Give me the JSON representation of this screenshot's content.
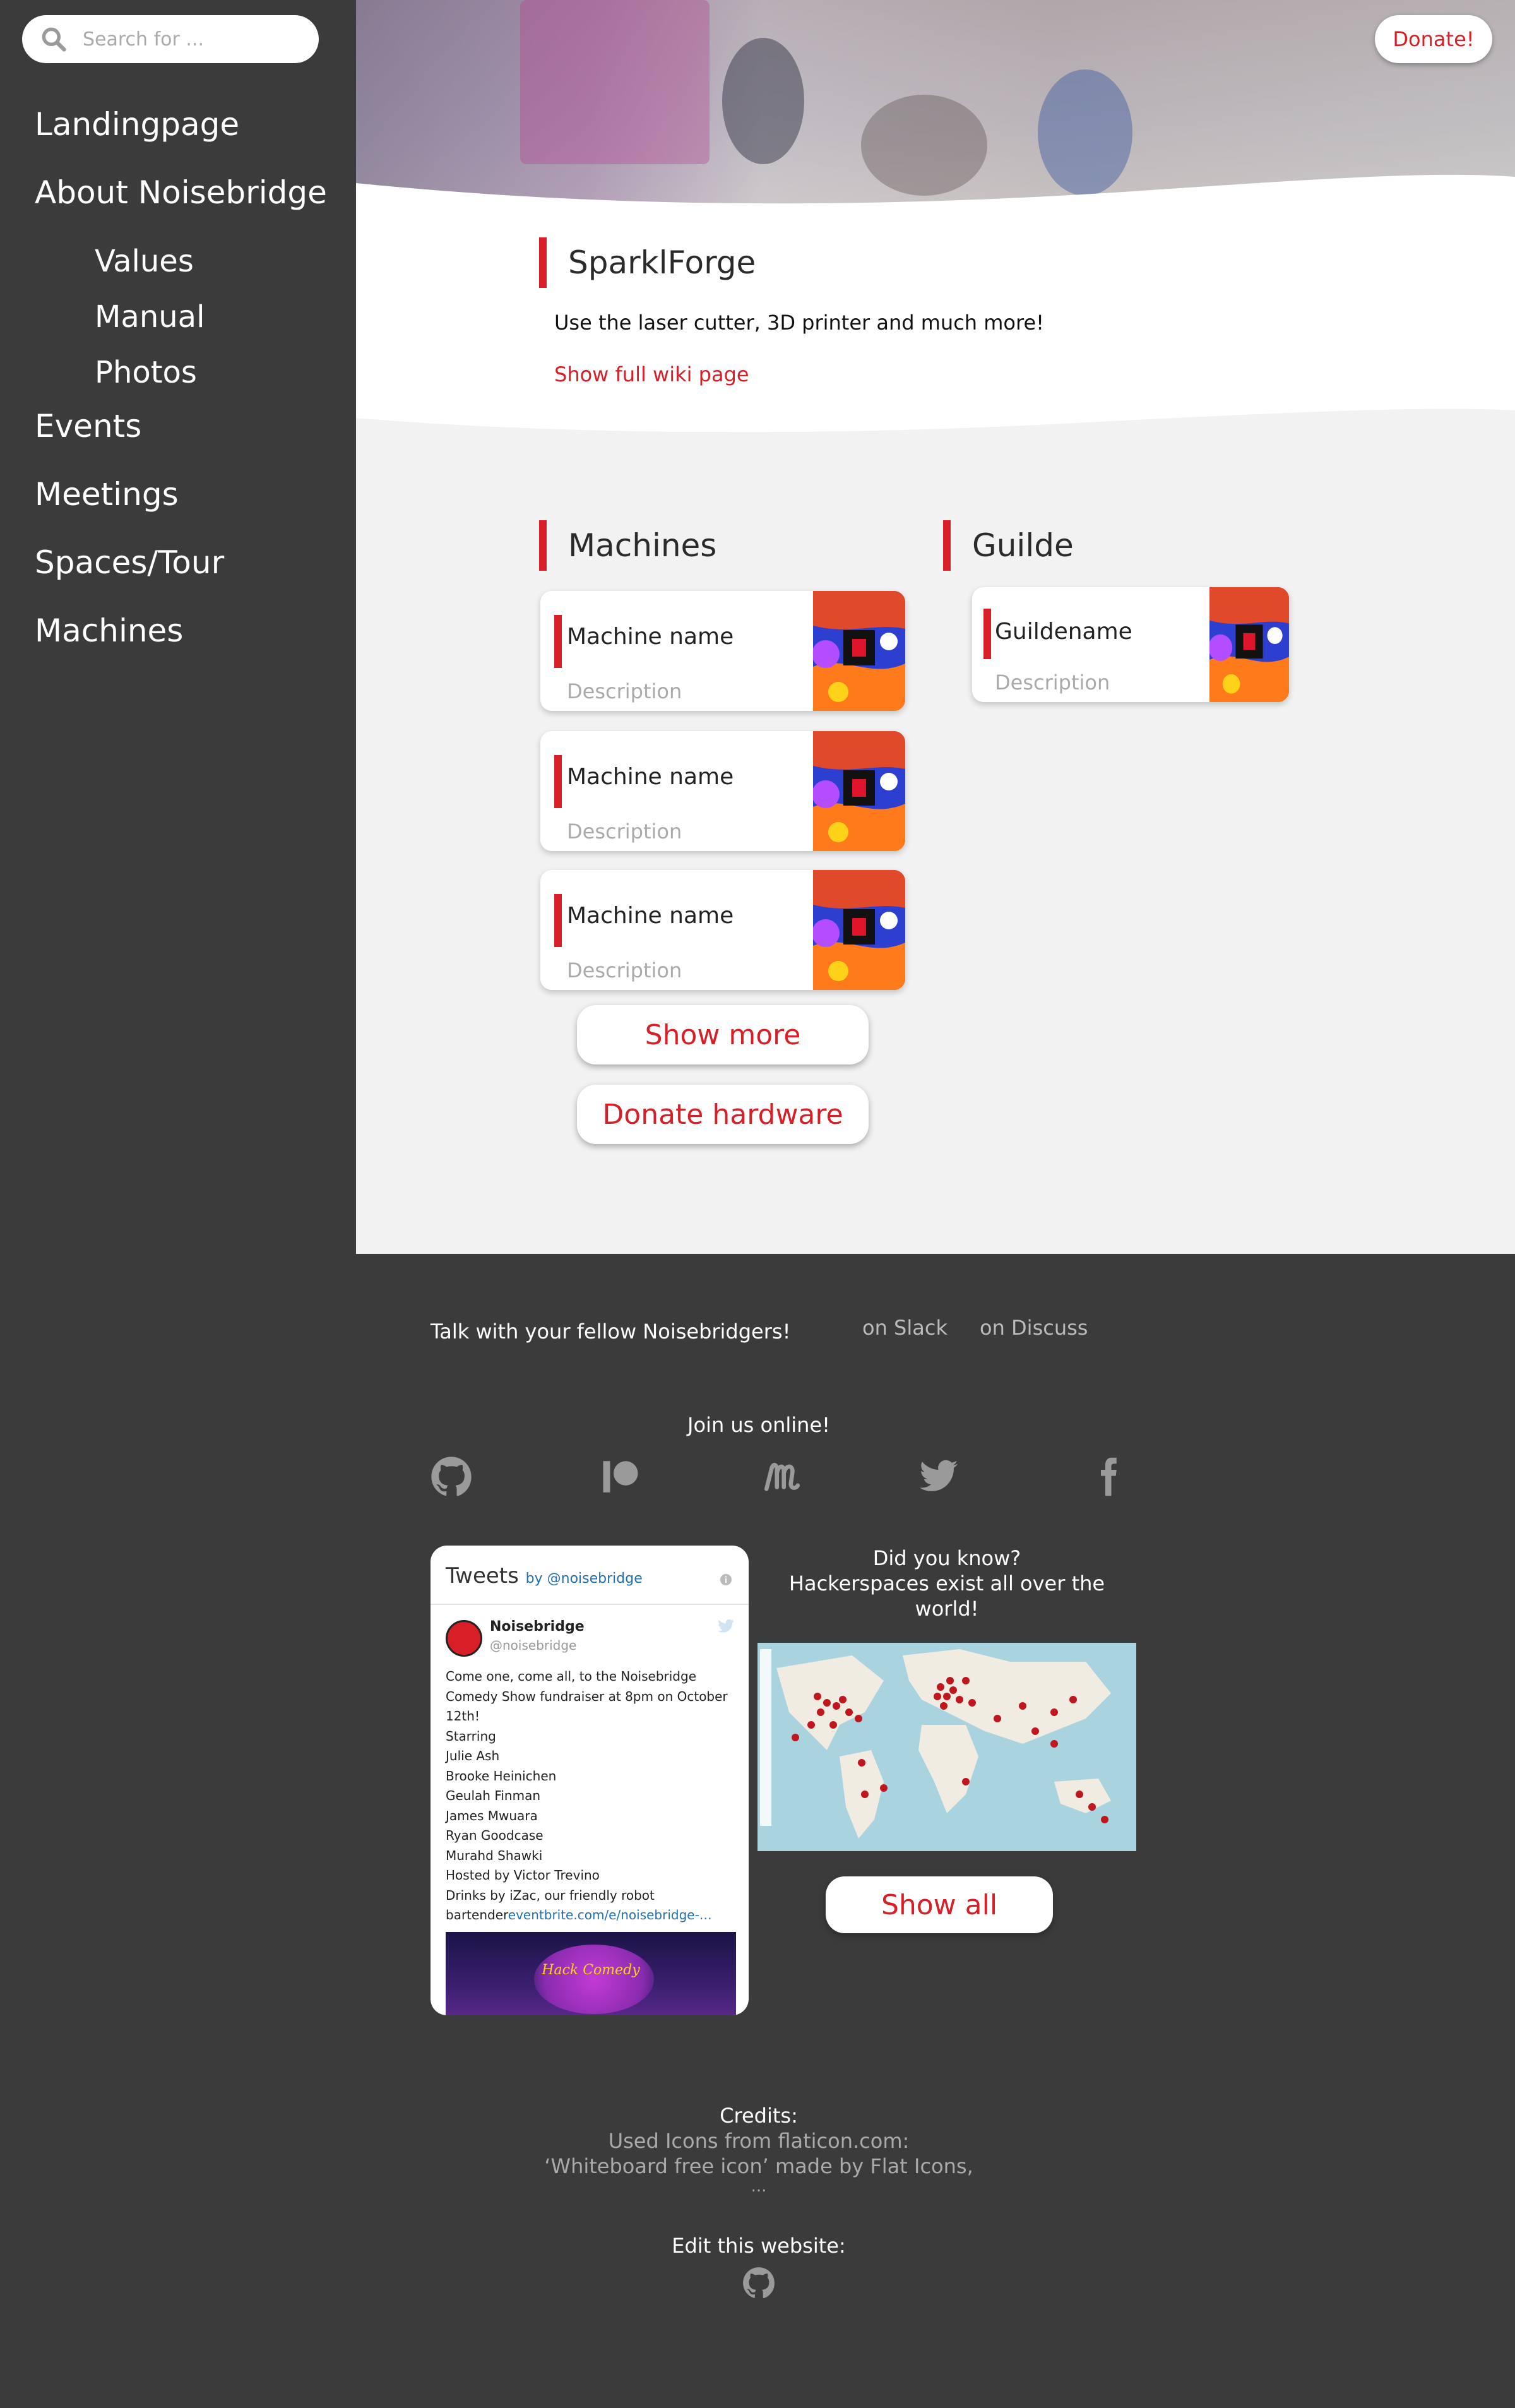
{
  "search": {
    "placeholder": "Search for ..."
  },
  "nav": {
    "items": [
      {
        "label": "Landingpage"
      },
      {
        "label": "About Noisebridge"
      },
      {
        "label": "Values"
      },
      {
        "label": "Manual"
      },
      {
        "label": "Photos"
      },
      {
        "label": "Events"
      },
      {
        "label": "Meetings"
      },
      {
        "label": "Spaces/Tour"
      },
      {
        "label": "Machines"
      }
    ]
  },
  "header": {
    "donate_label": "Donate!"
  },
  "intro": {
    "title": "SparklForge",
    "text": "Use the laser cutter, 3D printer and much more!",
    "wiki_link": "Show full wiki page"
  },
  "machines": {
    "title": "Machines",
    "cards": [
      {
        "name": "Machine name",
        "description": "Description"
      },
      {
        "name": "Machine name",
        "description": "Description"
      },
      {
        "name": "Machine name",
        "description": "Description"
      }
    ],
    "show_more": "Show more",
    "donate_hardware": "Donate hardware"
  },
  "guilde": {
    "title": "Guilde",
    "cards": [
      {
        "name": "Guildename",
        "description": "Description"
      }
    ]
  },
  "footer": {
    "talk": "Talk with your fellow Noisebridgers!",
    "slack": "on Slack",
    "discuss": "on Discuss",
    "join": "Join us online!",
    "social": [
      "github-icon",
      "patreon-icon",
      "meetup-icon",
      "twitter-icon",
      "facebook-icon"
    ],
    "tweets": {
      "title": "Tweets",
      "by": "by @noisebridge",
      "user": "Noisebridge",
      "handle": "@noisebridge",
      "lines": [
        "Come one, come all, to the Noisebridge Comedy Show fundraiser at 8pm on October 12th!",
        "Starring",
        "Julie Ash",
        "Brooke Heinichen",
        "Geulah Finman",
        "James Mwuara",
        "Ryan Goodcase",
        "Murahd Shawki",
        "Hosted by Victor Trevino",
        "Drinks by iZac, our friendly robot"
      ],
      "last_prefix": "bartender",
      "last_link": "eventbrite.com/e/noisebridge-…",
      "image_text": "Hack Comedy"
    },
    "didyouknow": "Did you know?",
    "hackerspaces": "Hackerspaces exist all over the world!",
    "show_all": "Show all",
    "credits_title": "Credits:",
    "credits_line1": "Used Icons from flaticon.com:",
    "credits_line2": "‘Whiteboard free icon’ made by Flat Icons,",
    "credits_line3": "...",
    "edit": "Edit this website:"
  },
  "colors": {
    "accent": "#d81e27",
    "sidebar": "#3b3b3b",
    "content_bg": "#f2f2f2"
  }
}
